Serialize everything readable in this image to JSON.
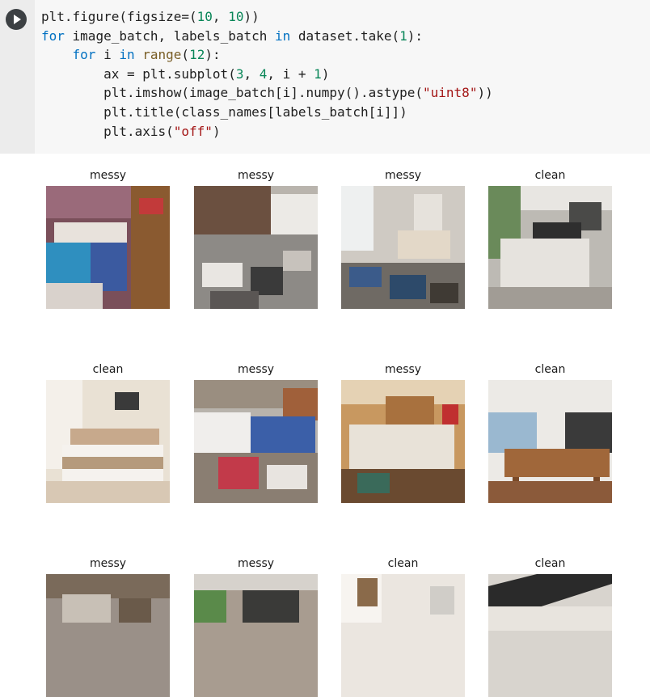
{
  "code_cell": {
    "lines": [
      [
        {
          "t": "plt.figure(figsize=("
        },
        {
          "t": "10",
          "c": "num"
        },
        {
          "t": ", "
        },
        {
          "t": "10",
          "c": "num"
        },
        {
          "t": "))"
        }
      ],
      [
        {
          "t": "for",
          "c": "kw"
        },
        {
          "t": " image_batch, labels_batch "
        },
        {
          "t": "in",
          "c": "kw"
        },
        {
          "t": " dataset.take("
        },
        {
          "t": "1",
          "c": "num"
        },
        {
          "t": "):"
        }
      ],
      [
        {
          "t": "    "
        },
        {
          "t": "for",
          "c": "kw"
        },
        {
          "t": " i "
        },
        {
          "t": "in",
          "c": "kw"
        },
        {
          "t": " "
        },
        {
          "t": "range",
          "c": "bi"
        },
        {
          "t": "("
        },
        {
          "t": "12",
          "c": "num"
        },
        {
          "t": "):"
        }
      ],
      [
        {
          "t": "        ax = plt.subplot("
        },
        {
          "t": "3",
          "c": "num"
        },
        {
          "t": ", "
        },
        {
          "t": "4",
          "c": "num"
        },
        {
          "t": ", i + "
        },
        {
          "t": "1",
          "c": "num"
        },
        {
          "t": ")"
        }
      ],
      [
        {
          "t": "        plt.imshow(image_batch[i].numpy().astype("
        },
        {
          "t": "\"uint8\"",
          "c": "str"
        },
        {
          "t": "))"
        }
      ],
      [
        {
          "t": "        plt.title(class_names[labels_batch[i]])"
        }
      ],
      [
        {
          "t": "        plt.axis("
        },
        {
          "t": "\"off\"",
          "c": "str"
        },
        {
          "t": ")"
        }
      ]
    ]
  },
  "output": {
    "images": [
      {
        "title": "messy"
      },
      {
        "title": "messy"
      },
      {
        "title": "messy"
      },
      {
        "title": "clean"
      },
      {
        "title": "clean"
      },
      {
        "title": "messy"
      },
      {
        "title": "messy"
      },
      {
        "title": "clean"
      },
      {
        "title": "messy"
      },
      {
        "title": "messy"
      },
      {
        "title": "clean"
      },
      {
        "title": "clean"
      }
    ]
  }
}
